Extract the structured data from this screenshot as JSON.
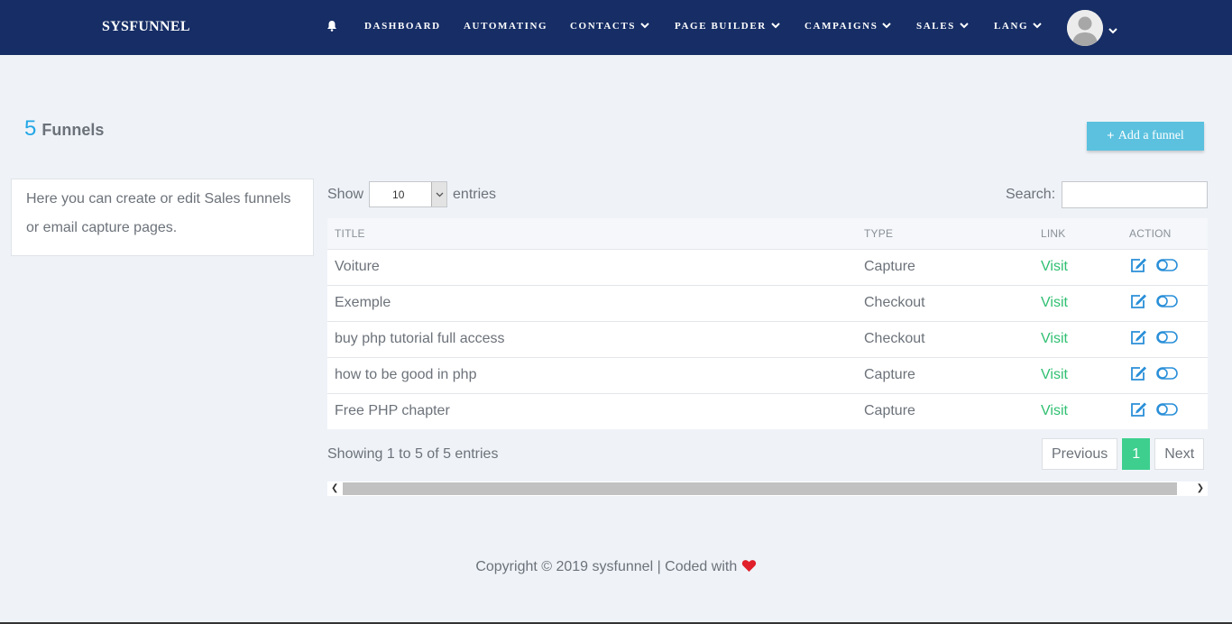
{
  "app": {
    "brand": "SYSFUNNEL"
  },
  "nav": {
    "items": [
      {
        "label": "DASHBOARD",
        "dropdown": false
      },
      {
        "label": "AUTOMATING",
        "dropdown": false
      },
      {
        "label": "CONTACTS",
        "dropdown": true
      },
      {
        "label": "PAGE BUILDER",
        "dropdown": true
      },
      {
        "label": "CAMPAIGNS",
        "dropdown": true
      },
      {
        "label": "SALES",
        "dropdown": true
      },
      {
        "label": "LANG",
        "dropdown": true
      }
    ]
  },
  "header": {
    "count": "5",
    "title": "Funnels",
    "add_button": "Add a funnel"
  },
  "info": {
    "text": "Here you can create or edit Sales funnels or email capture pages."
  },
  "table_controls": {
    "show_label": "Show",
    "entries_value": "10",
    "entries_label": "entries",
    "search_label": "Search:",
    "search_value": ""
  },
  "table": {
    "columns": [
      "TITLE",
      "TYPE",
      "LINK",
      "ACTION"
    ],
    "rows": [
      {
        "title": "Voiture",
        "type": "Capture",
        "link": "Visit"
      },
      {
        "title": "Exemple",
        "type": "Checkout",
        "link": "Visit"
      },
      {
        "title": "buy php tutorial full access",
        "type": "Checkout",
        "link": "Visit"
      },
      {
        "title": "how to be good in php",
        "type": "Capture",
        "link": "Visit"
      },
      {
        "title": "Free PHP chapter",
        "type": "Capture",
        "link": "Visit"
      }
    ]
  },
  "pagination": {
    "summary": "Showing 1 to 5 of 5 entries",
    "previous": "Previous",
    "current": "1",
    "next": "Next"
  },
  "footer": {
    "text": "Copyright © 2019 sysfunnel | Coded with"
  },
  "colors": {
    "navbar": "#162d65",
    "accent_blue": "#23a7e6",
    "button": "#5bc1df",
    "link_green": "#2fbf71",
    "page_active": "#3ecf8e",
    "heart": "#e0202a"
  }
}
